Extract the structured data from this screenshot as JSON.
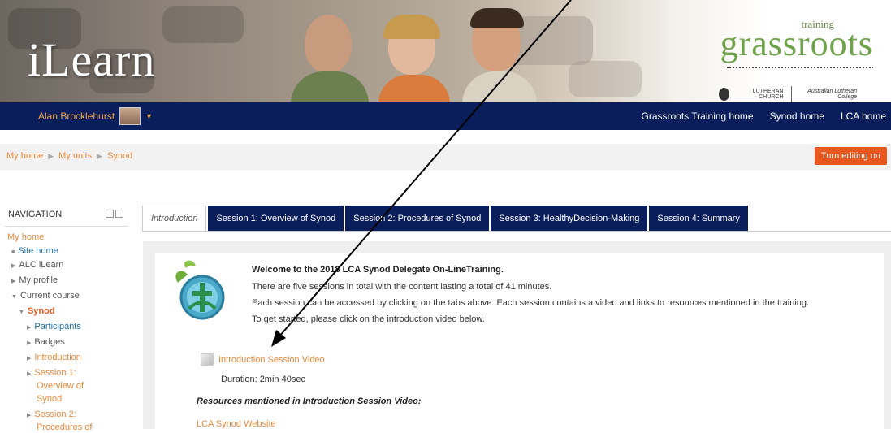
{
  "banner": {
    "logo_text": "iLearn",
    "brand": {
      "training": "training",
      "name": "grassroots",
      "partner_church": "LUTHERAN CHURCH",
      "partner_college": "Australian Lutheran College"
    }
  },
  "navbar": {
    "user_name": "Alan Brocklehurst",
    "links": [
      "Grassroots Training home",
      "Synod home",
      "LCA home"
    ]
  },
  "breadcrumb": {
    "items": [
      "My home",
      "My units",
      "Synod"
    ]
  },
  "edit_button": "Turn editing on",
  "navigation": {
    "title": "NAVIGATION",
    "items": [
      {
        "label": "My home"
      },
      {
        "label": "Site home"
      },
      {
        "label": "ALC iLearn"
      },
      {
        "label": "My profile"
      },
      {
        "label": "Current course"
      },
      {
        "label": "Synod"
      },
      {
        "label": "Participants"
      },
      {
        "label": "Badges"
      },
      {
        "label": "Introduction"
      },
      {
        "label": "Session 1:"
      },
      {
        "label": "Overview of"
      },
      {
        "label": "Synod"
      },
      {
        "label": "Session 2:"
      },
      {
        "label": "Procedures of"
      }
    ]
  },
  "tabs": [
    {
      "label": "Introduction"
    },
    {
      "label": "Session 1: Overview of Synod"
    },
    {
      "label": "Session 2: Procedures of Synod"
    },
    {
      "label": "Session 3: HealthyDecision-Making"
    },
    {
      "label": "Session 4: Summary"
    }
  ],
  "content": {
    "welcome_title": "Welcome to the 2018 LCA Synod Delegate On-LineTraining.",
    "lines": [
      "There are five sessions in total with the content lasting a total of 41 minutes.",
      "Each session can be accessed by clicking on the tabs above. Each session contains a video and links to resources mentioned in the training.",
      "To get started, please click on the introduction video below."
    ],
    "video_link": "Introduction Session Video",
    "duration": "Duration: 2min 40sec",
    "resources_title": "Resources mentioned in Introduction Session Video:",
    "resource_link": "LCA Synod Website"
  },
  "colors": {
    "navy": "#0a1e5c",
    "link_orange": "#e8893c",
    "button_orange": "#e8571e",
    "brand_green": "#6fa34a"
  },
  "icons": {
    "user_caret": "caret-down-icon",
    "breadcrumb_sep": "triangle-right-icon",
    "video": "video-file-icon",
    "arrow": "annotation-arrow"
  }
}
